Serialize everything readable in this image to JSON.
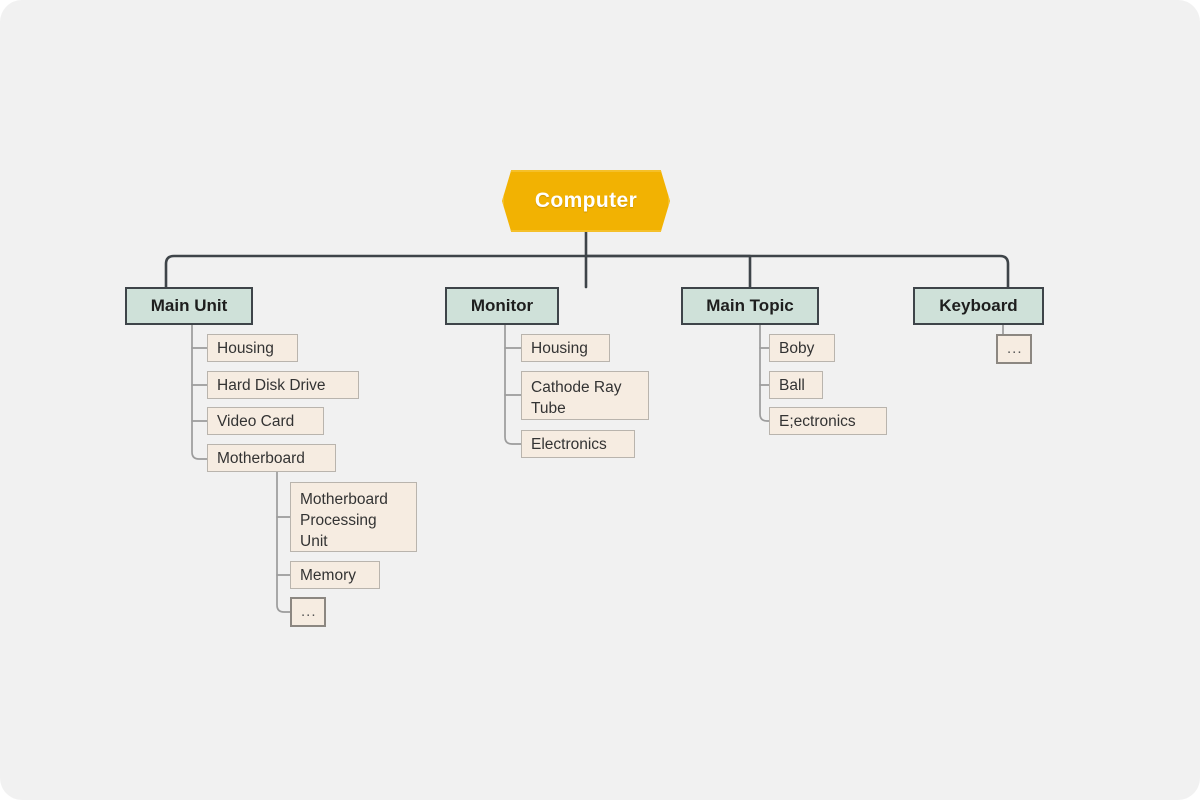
{
  "diagram": {
    "type": "mind-map",
    "title": "Computer",
    "background_color": "#f1f1f1",
    "root": {
      "label": "Computer",
      "shape": "hexagon",
      "fill": "#f2b202",
      "text_color": "#ffffff"
    },
    "branch_fill": "#cfe1d9",
    "branch_border": "#3e4449",
    "leaf_fill": "#f6ece1",
    "leaf_border": "#b9b4ad",
    "connector_color_main": "#3e4449",
    "connector_color_sub": "#9c9c9c",
    "branches": [
      {
        "label": "Main Unit",
        "children": [
          {
            "label": "Housing"
          },
          {
            "label": "Hard Disk Drive"
          },
          {
            "label": "Video Card"
          },
          {
            "label": "Motherboard",
            "children": [
              {
                "label": "Motherboard Processing Unit",
                "lines": [
                  "Motherboard",
                  "Processing",
                  "Unit"
                ]
              },
              {
                "label": "Memory"
              },
              {
                "label": "..."
              }
            ]
          }
        ]
      },
      {
        "label": "Monitor",
        "children": [
          {
            "label": "Housing"
          },
          {
            "label": "Cathode Ray Tube",
            "lines": [
              "Cathode Ray",
              "Tube"
            ]
          },
          {
            "label": "Electronics"
          }
        ]
      },
      {
        "label": "Main Topic",
        "children": [
          {
            "label": "Boby"
          },
          {
            "label": "Ball"
          },
          {
            "label": "E;ectronics"
          }
        ]
      },
      {
        "label": "Keyboard",
        "children": [
          {
            "label": "..."
          }
        ]
      }
    ]
  },
  "nodes": {
    "root": "Computer",
    "b0": "Main Unit",
    "b0c0": "Housing",
    "b0c1": "Hard Disk Drive",
    "b0c2": "Video Card",
    "b0c3": "Motherboard",
    "b0c3g0l0": "Motherboard",
    "b0c3g0l1": "Processing",
    "b0c3g0l2": "Unit",
    "b0c3g1": "Memory",
    "b0c3g2": "...",
    "b1": "Monitor",
    "b1c0": "Housing",
    "b1c1l0": "Cathode Ray",
    "b1c1l1": "Tube",
    "b1c2": "Electronics",
    "b2": "Main Topic",
    "b2c0": "Boby",
    "b2c1": "Ball",
    "b2c2": "E;ectronics",
    "b3": "Keyboard",
    "b3c0": "..."
  }
}
